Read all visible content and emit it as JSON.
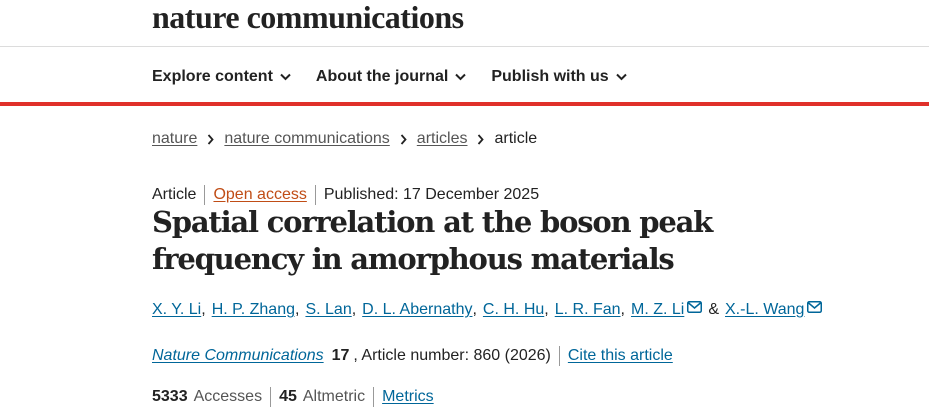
{
  "header": {
    "brand": "nature communications"
  },
  "nav": {
    "items": [
      {
        "label": "Explore content"
      },
      {
        "label": "About the journal"
      },
      {
        "label": "Publish with us"
      }
    ]
  },
  "breadcrumb": {
    "items": [
      "nature",
      "nature communications",
      "articles"
    ],
    "current": "article"
  },
  "article": {
    "type": "Article",
    "access": "Open access",
    "published": "Published: 17 December 2025",
    "title": "Spatial correlation at the boson peak frequency in amorphous materials",
    "authors": [
      "X. Y. Li",
      "H. P. Zhang",
      "S. Lan",
      "D. L. Abernathy",
      "C. H. Hu",
      "L. R. Fan",
      "M. Z. Li",
      "X.-L. Wang"
    ],
    "amp": "&",
    "journal": "Nature Communications",
    "volume": "17",
    "article_number": ", Article number: 860 (2026)",
    "cite_label": "Cite this article"
  },
  "metrics": {
    "accesses_value": "5333",
    "accesses_label": "Accesses",
    "altmetric_value": "45",
    "altmetric_label": "Altmetric",
    "metrics_link": "Metrics"
  },
  "colors": {
    "accent_red": "#e0302a",
    "link_blue": "#006699",
    "open_access": "#c04d16"
  }
}
